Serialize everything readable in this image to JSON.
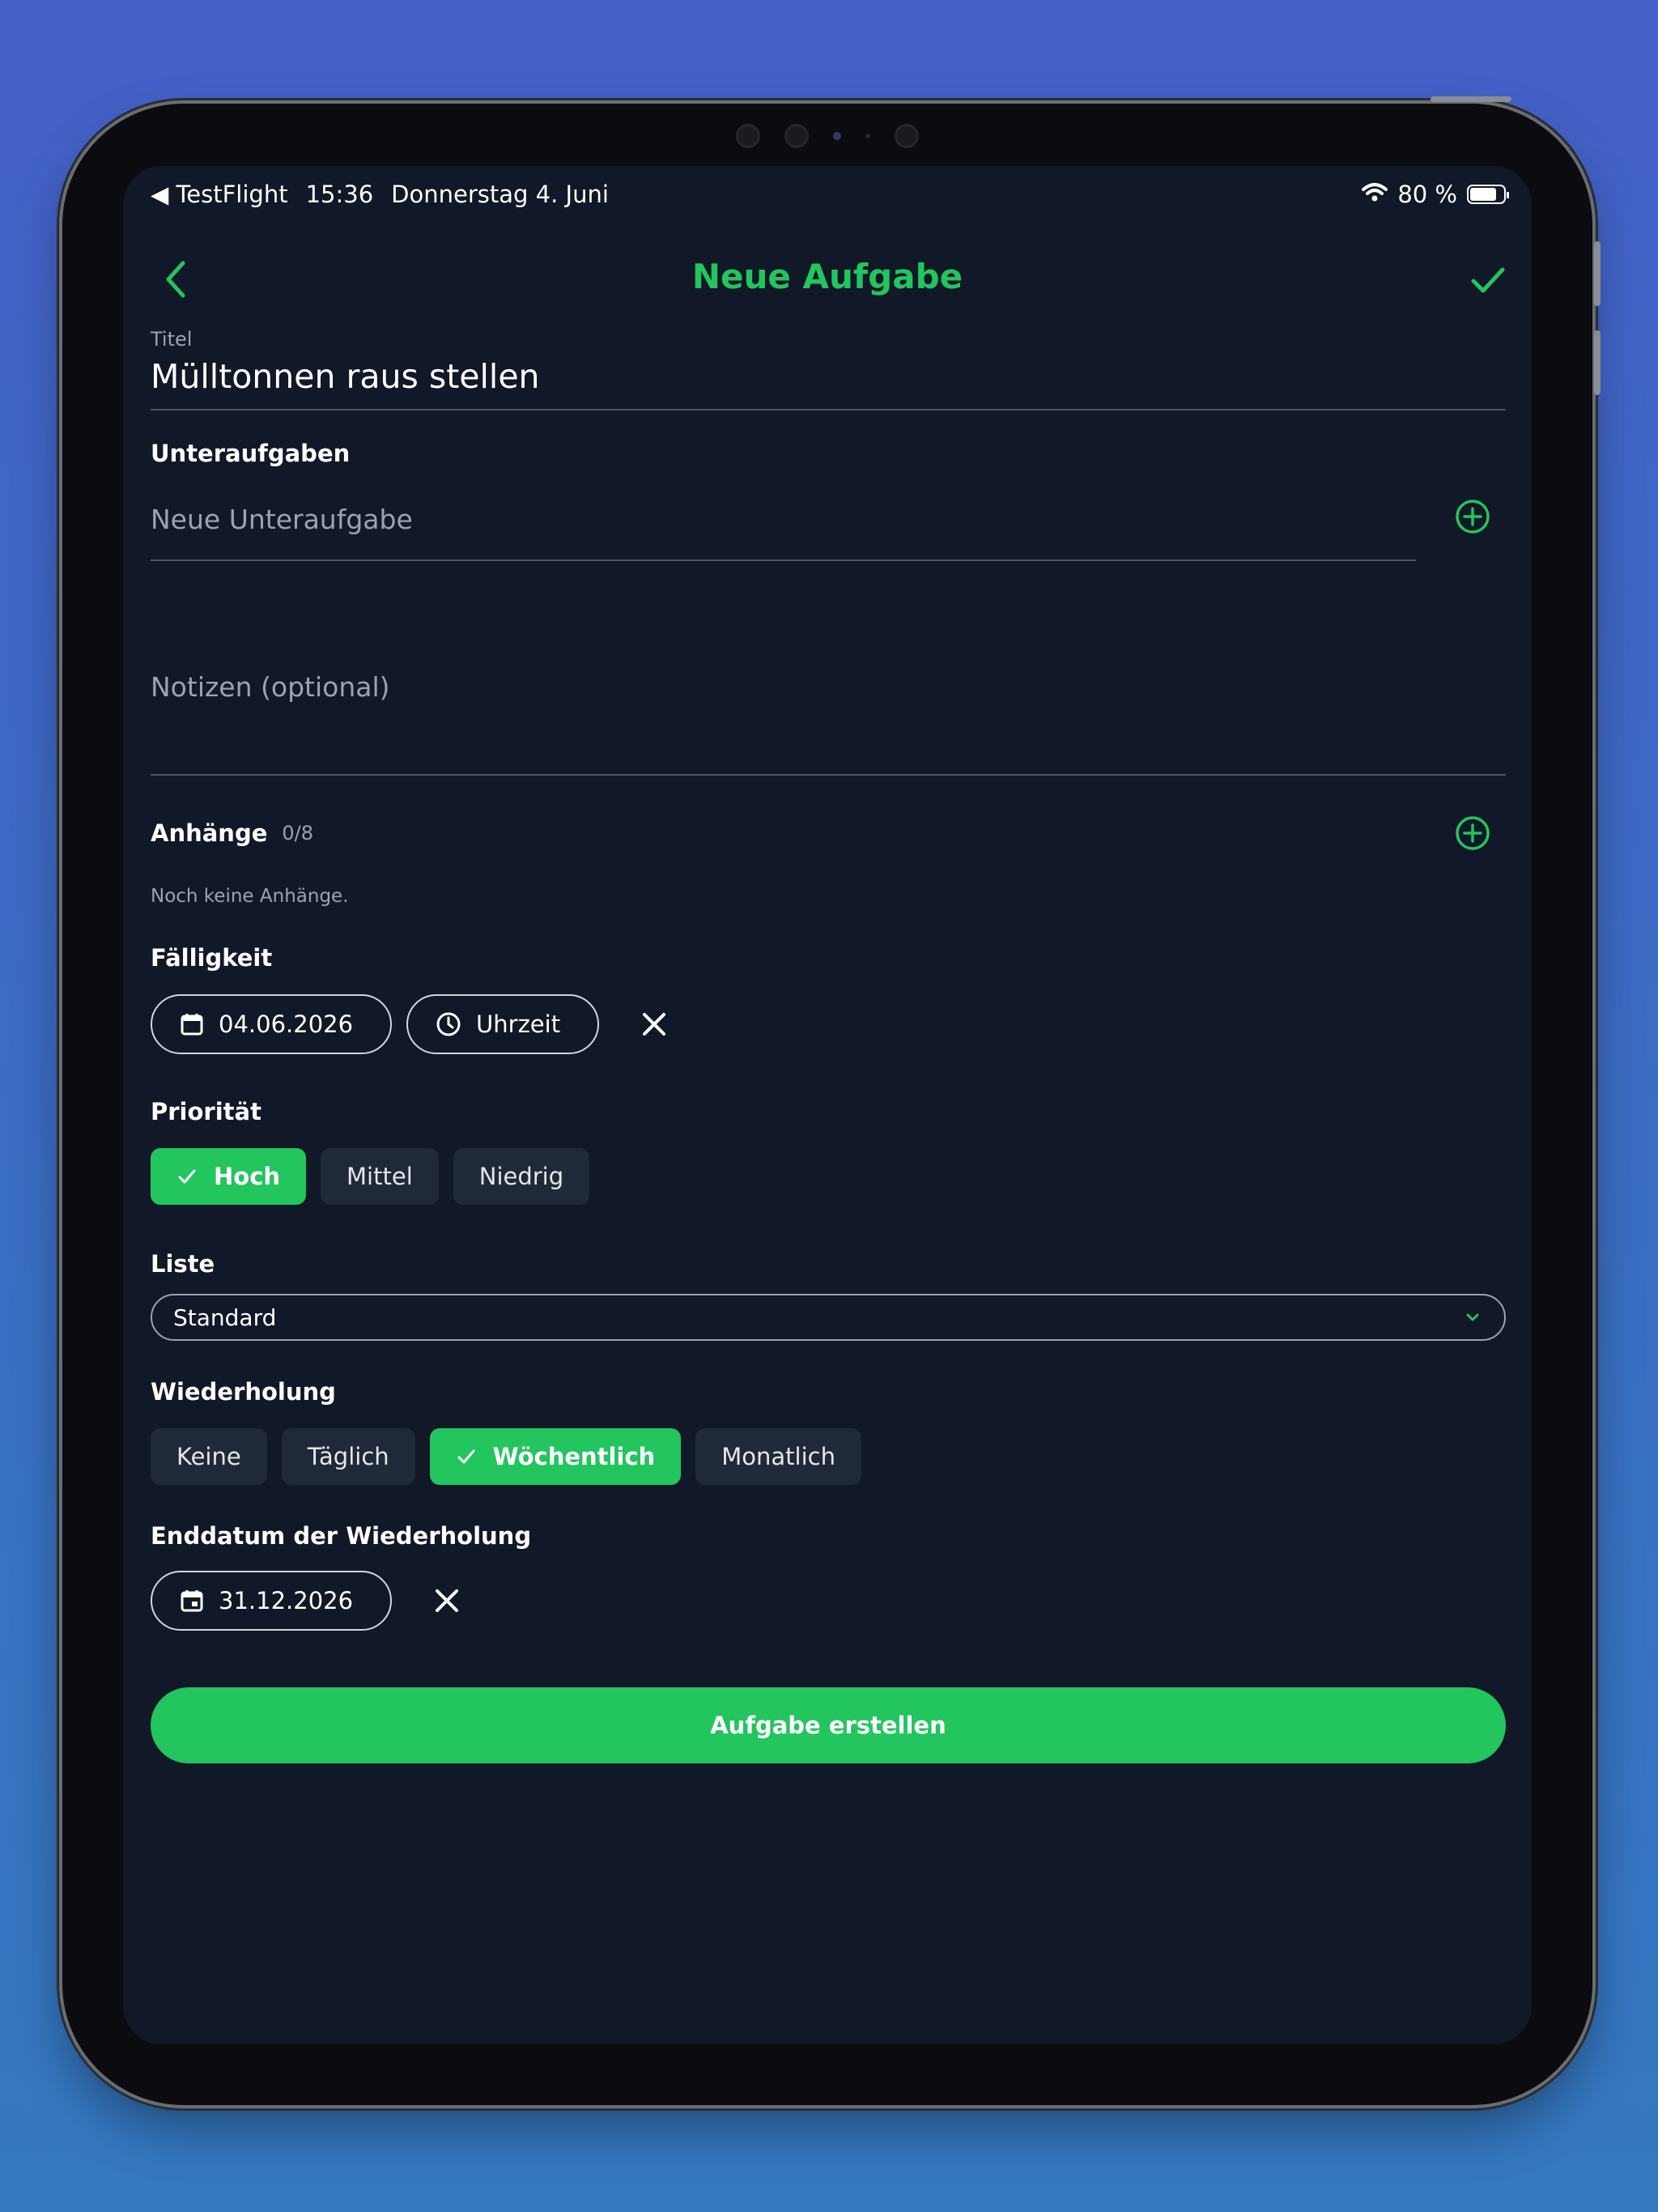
{
  "status_bar": {
    "back_app": "◀ TestFlight",
    "time": "15:36",
    "date": "Donnerstag 4. Juni",
    "battery": "80 %",
    "battery_level": 0.8
  },
  "nav": {
    "title": "Neue Aufgabe"
  },
  "form": {
    "title_label": "Titel",
    "title_value": "Mülltonnen raus stellen",
    "subtasks_label": "Unteraufgaben",
    "subtask_placeholder": "Neue Unteraufgabe",
    "notes_placeholder": "Notizen (optional)",
    "attachments_label": "Anhänge",
    "attachments_count": "0/8",
    "attachments_empty": "Noch keine Anhänge.",
    "due_label": "Fälligkeit",
    "due_date": "04.06.2026",
    "due_time": "Uhrzeit",
    "priority_label": "Priorität",
    "priority_options": [
      "Hoch",
      "Mittel",
      "Niedrig"
    ],
    "priority_selected": "Hoch",
    "list_label": "Liste",
    "list_value": "Standard",
    "repeat_label": "Wiederholung",
    "repeat_options": [
      "Keine",
      "Täglich",
      "Wöchentlich",
      "Monatlich"
    ],
    "repeat_selected": "Wöchentlich",
    "repeat_end_label": "Enddatum der Wiederholung",
    "repeat_end_date": "31.12.2026",
    "submit_label": "Aufgabe erstellen"
  },
  "colors": {
    "accent": "#22c55e",
    "background": "#111827",
    "chip": "#1f2937"
  },
  "icons": {
    "back": "chevron-left-icon",
    "confirm": "checkmark-icon",
    "add": "plus-circle-icon",
    "calendar": "calendar-icon",
    "clock": "clock-icon",
    "clear": "close-icon",
    "dropdown": "chevron-down-icon"
  }
}
